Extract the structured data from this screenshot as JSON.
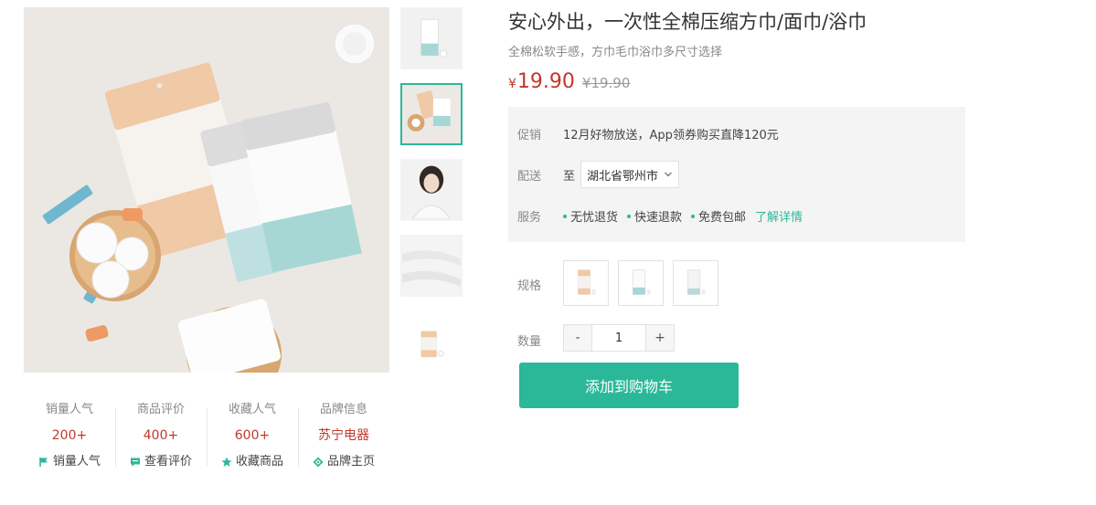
{
  "product": {
    "title": "安心外出，一次性全棉压缩方巾/面巾/浴巾",
    "subtitle": "全棉松软手感，方巾毛巾浴巾多尺寸选择",
    "price": {
      "currency": "¥",
      "current": "19.90",
      "original": "¥19.90"
    }
  },
  "gallery": {
    "main_image": "product-main-image",
    "thumbnails": [
      {
        "name": "thumbnail-pack-white"
      },
      {
        "name": "thumbnail-product-flatlay",
        "selected": true
      },
      {
        "name": "thumbnail-model-photo"
      },
      {
        "name": "thumbnail-towel-texture"
      },
      {
        "name": "thumbnail-pack-small"
      }
    ]
  },
  "stats": [
    {
      "title": "销量人气",
      "value": "200+",
      "link": "销量人气",
      "icon": "flag-icon"
    },
    {
      "title": "商品评价",
      "value": "400+",
      "link": "查看评价",
      "icon": "comment-icon"
    },
    {
      "title": "收藏人气",
      "value": "600+",
      "link": "收藏商品",
      "icon": "star-icon"
    },
    {
      "title": "品牌信息",
      "value": "苏宁电器",
      "link": "品牌主页",
      "icon": "brand-icon"
    }
  ],
  "info": {
    "promo_label": "促销",
    "promo_text": "12月好物放送，App领券购买直降120元",
    "ship_label": "配送",
    "ship_to": "至",
    "ship_address": "湖北省鄂州市",
    "service_label": "服务",
    "services": [
      "无忧退货",
      "快速退款",
      "免费包邮"
    ],
    "service_more": "了解详情"
  },
  "spec": {
    "label": "规格",
    "options": [
      "spec-option-orange",
      "spec-option-teal",
      "spec-option-white"
    ]
  },
  "quantity": {
    "label": "数量",
    "minus": "-",
    "value": "1",
    "plus": "+"
  },
  "actions": {
    "add_to_cart": "添加到购物车"
  },
  "colors": {
    "accent": "#2bb899",
    "price": "#c0392b"
  }
}
